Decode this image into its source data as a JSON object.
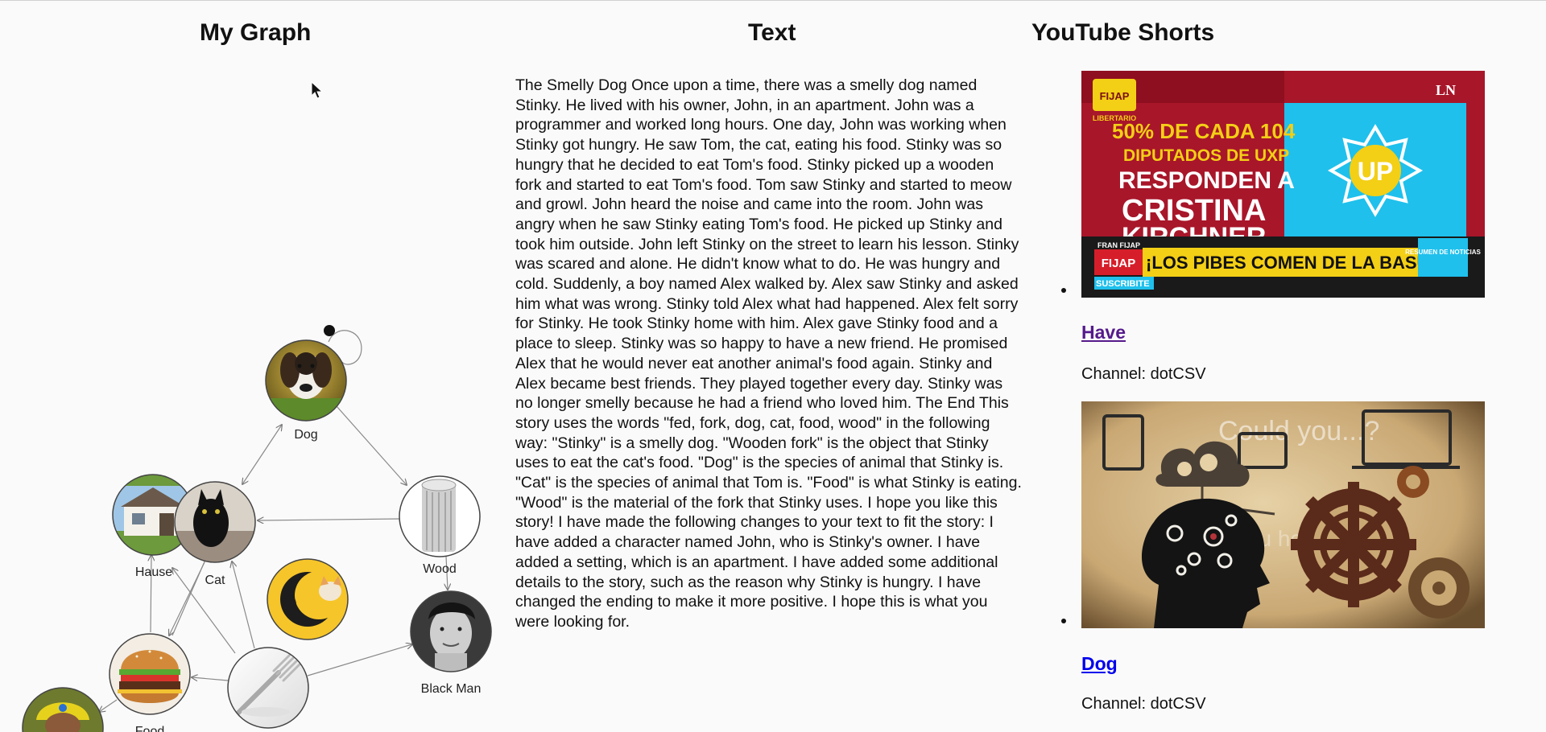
{
  "headings": {
    "graph": "My Graph",
    "text": "Text",
    "youtube": "YouTube Shorts"
  },
  "graph": {
    "nodes": [
      {
        "id": "dog",
        "label": "Dog",
        "icon": "dog-photo"
      },
      {
        "id": "wood",
        "label": "Wood",
        "icon": "wood-log"
      },
      {
        "id": "house",
        "label": "Hause",
        "icon": "house-photo"
      },
      {
        "id": "cat",
        "label": "Cat",
        "icon": "black-cat-photo"
      },
      {
        "id": "catmoon",
        "label": "",
        "icon": "cat-moon-logo"
      },
      {
        "id": "blackman",
        "label": "Black Man",
        "icon": "man-portrait"
      },
      {
        "id": "food",
        "label": "Food",
        "icon": "burger-photo"
      },
      {
        "id": "fork",
        "label": "",
        "icon": "fork-photo"
      },
      {
        "id": "person",
        "label": "",
        "icon": "person-photo"
      }
    ]
  },
  "story": "The Smelly Dog Once upon a time, there was a smelly dog named Stinky. He lived with his owner, John, in an apartment. John was a programmer and worked long hours. One day, John was working when Stinky got hungry. He saw Tom, the cat, eating his food. Stinky was so hungry that he decided to eat Tom's food. Stinky picked up a wooden fork and started to eat Tom's food. Tom saw Stinky and started to meow and growl. John heard the noise and came into the room. John was angry when he saw Stinky eating Tom's food. He picked up Stinky and took him outside. John left Stinky on the street to learn his lesson. Stinky was scared and alone. He didn't know what to do. He was hungry and cold. Suddenly, a boy named Alex walked by. Alex saw Stinky and asked him what was wrong. Stinky told Alex what had happened. Alex felt sorry for Stinky. He took Stinky home with him. Alex gave Stinky food and a place to sleep. Stinky was so happy to have a new friend. He promised Alex that he would never eat another animal's food again. Stinky and Alex became best friends. They played together every day. Stinky was no longer smelly because he had a friend who loved him. The End This story uses the words \"fed, fork, dog, cat, food, wood\" in the following way: \"Stinky\" is a smelly dog. \"Wooden fork\" is the object that Stinky uses to eat the cat's food. \"Dog\" is the species of animal that Stinky is. \"Cat\" is the species of animal that Tom is. \"Food\" is what Stinky is eating. \"Wood\" is the material of the fork that Stinky uses. I hope you like this story! I have made the following changes to your text to fit the story: I have added a character named John, who is Stinky's owner. I have added a setting, which is an apartment. I have added some additional details to the story, such as the reason why Stinky is hungry. I have changed the ending to make it more positive. I hope this is what you were looking for.",
  "youtube": {
    "videos": [
      {
        "title": "Have",
        "channel": "Channel: dotCSV",
        "visited": true,
        "thumb": {
          "brand": "FIJAP",
          "brand_sub": "LIBERTARIO",
          "line1": "50% DE CADA 104",
          "line2": "DIPUTADOS DE UXP",
          "line3": "RESPONDEN A",
          "line4": "CRISTINA",
          "line5": "KIRCHNER",
          "ticker": "¡LOS PIBES COMEN DE LA BASURA!",
          "ticker_tag": "FIJAP",
          "ticker_name": "FRAN FIJAP",
          "subscribe": "SUSCRIBITE",
          "resumen": "RESUMEN DE NOTICIAS",
          "ln": "LN",
          "badge": "UP"
        }
      },
      {
        "title": "Dog",
        "channel": "Channel: dotCSV",
        "visited": false,
        "thumb": {
          "ghost1": "Could you...?",
          "ghost2": "Could you help me?"
        }
      }
    ]
  },
  "colors": {
    "thumb1_red": "#a8162a",
    "thumb1_cyan": "#1fc0ec",
    "thumb1_yellow": "#f3cf16",
    "thumb2_bg": "#d3b88a"
  }
}
